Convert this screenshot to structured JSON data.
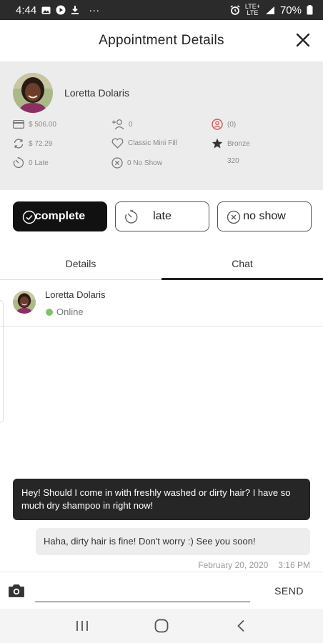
{
  "status_bar": {
    "time": "4:44",
    "extra": "···",
    "lte_top": "LTE+",
    "lte_bottom": "LTE",
    "battery": "70%"
  },
  "header": {
    "title": "Appointment Details"
  },
  "profile": {
    "name": "Loretta Dolaris",
    "stats": {
      "spent": "$ 506.00",
      "referrals": "0",
      "flags": "(0)",
      "average": "$ 72.29",
      "favorite": "Classic Mini Fill",
      "tier": "Bronze",
      "late": "0 Late",
      "no_show": "0 No Show",
      "points": "320"
    }
  },
  "actions": [
    {
      "label": "complete",
      "icon": "check-circle-icon",
      "active": true
    },
    {
      "label": "late",
      "icon": "timer-icon",
      "active": false
    },
    {
      "label": "no show",
      "icon": "x-circle-icon",
      "active": false
    }
  ],
  "tabs": [
    {
      "label": "Details",
      "active": false
    },
    {
      "label": "Chat",
      "active": true
    }
  ],
  "chat": {
    "contact_name": "Loretta Dolaris",
    "status": "Online",
    "status_color": "#7cc66b",
    "messages": [
      {
        "from": "client",
        "text": "Hey! Should I come in with freshly washed or dirty hair? I have so much dry shampoo in right now!"
      },
      {
        "from": "me",
        "text": "Haha, dirty hair is fine! Don't worry :) See you soon!"
      }
    ],
    "timestamp_date": "February 20, 2020",
    "timestamp_time": "3:16 PM"
  },
  "composer": {
    "placeholder": "",
    "send_label": "SEND"
  },
  "colors": {
    "accent_dark": "#111111",
    "profile_bg": "#ececec",
    "alert_red": "#d9534f"
  }
}
